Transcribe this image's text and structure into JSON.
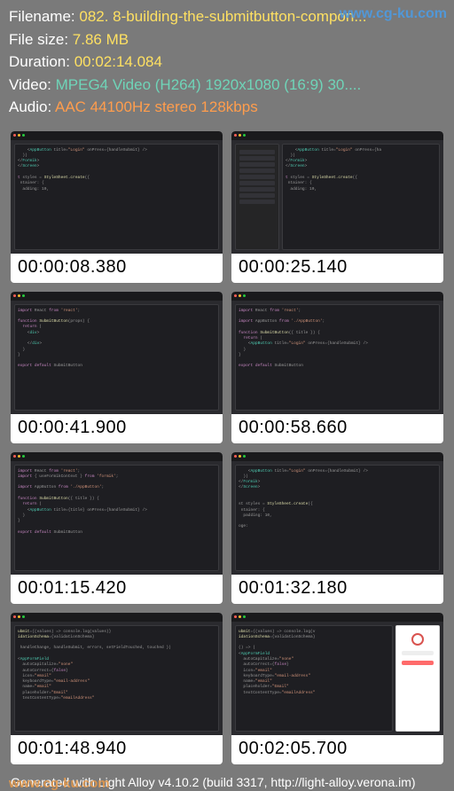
{
  "watermarks": {
    "top": "www.cg-ku.com",
    "bottom": "www.cg-ku.com"
  },
  "header": {
    "filename_label": "Filename: ",
    "filename_value": "082. 8-building-the-submitbutton-compon...",
    "filesize_label": "File size: ",
    "filesize_value": "7.86 MB",
    "duration_label": "Duration: ",
    "duration_value": "00:02:14.084",
    "video_label": "Video: ",
    "video_value": "MPEG4 Video (H264) 1920x1080 (16:9) 30....",
    "audio_label": "Audio: ",
    "audio_value": "AAC 44100Hz stereo 128kbps"
  },
  "thumbs": [
    {
      "ts": "00:00:08.380"
    },
    {
      "ts": "00:00:25.140"
    },
    {
      "ts": "00:00:41.900"
    },
    {
      "ts": "00:00:58.660"
    },
    {
      "ts": "00:01:15.420"
    },
    {
      "ts": "00:01:32.180"
    },
    {
      "ts": "00:01:48.940"
    },
    {
      "ts": "00:02:05.700"
    }
  ],
  "footer": "Generated with Light Alloy v4.10.2 (build 3317, http://light-alloy.verona.im)"
}
